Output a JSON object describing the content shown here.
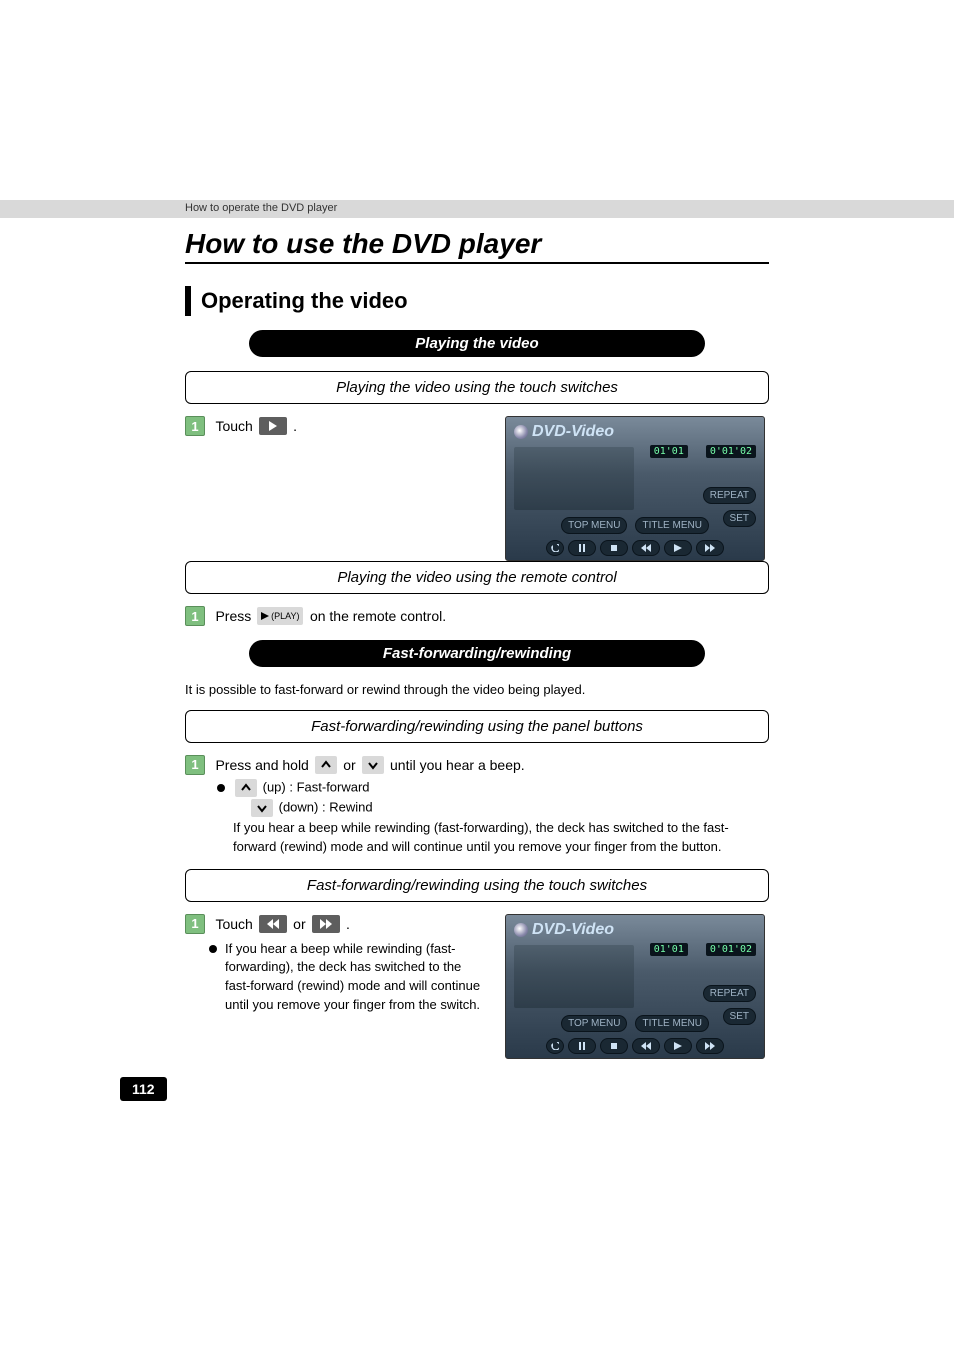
{
  "breadcrumb": "How to operate the DVD player",
  "title": "How to use the DVD player",
  "section_title": "Operating the video",
  "pill1": "Playing the video",
  "sub1a": "Playing the video using the touch switches",
  "step1a_num": "1",
  "step1a_text_pre": "Touch ",
  "step1a_text_post": " .",
  "sub1b": "Playing the video using the remote control",
  "step1b_num": "1",
  "step1b_text_pre": "Press ",
  "step1b_play_label": "(PLAY)",
  "step1b_text_post": " on the remote control.",
  "pill2": "Fast-forwarding/rewinding",
  "para_ff": "It is possible to fast-forward or rewind through the video being played.",
  "sub2a": "Fast-forwarding/rewinding using the panel buttons",
  "step2a_num": "1",
  "step2a_text_pre": "Press and hold ",
  "step2a_text_mid": " or ",
  "step2a_text_post": " until you hear a beep.",
  "bullet_up": "(up) : Fast-forward",
  "bullet_down": "(down) : Rewind",
  "bullet_body": "If you hear a beep while rewinding (fast-forwarding), the deck has switched to the fast-forward (rewind) mode and will continue until you remove your finger from the button.",
  "sub2b": "Fast-forwarding/rewinding using the touch switches",
  "step2b_num": "1",
  "step2b_text_pre": "Touch ",
  "step2b_text_mid": " or ",
  "step2b_text_post": " .",
  "bullet2b": "If you hear a beep while rewinding (fast-forwarding), the deck has switched to the fast-forward (rewind) mode and will continue until you remove your finger from the switch.",
  "screenshot": {
    "logo": "DVD-Video",
    "counter1": "01'01",
    "counter2": "0'01'02",
    "btn_repeat": "REPEAT",
    "btn_set": "SET",
    "btn_top": "TOP MENU",
    "btn_title": "TITLE MENU"
  },
  "page_number": "112"
}
